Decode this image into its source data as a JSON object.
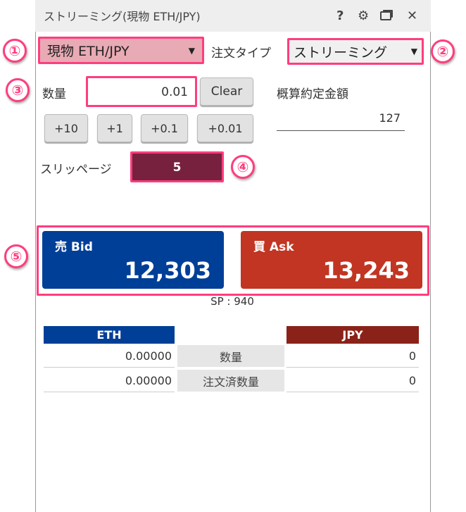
{
  "window": {
    "title": "ストリーミング(現物 ETH/JPY)",
    "icons": [
      "help-icon",
      "gear-icon",
      "restore-icon",
      "close-icon"
    ]
  },
  "annotations": [
    "①",
    "②",
    "③",
    "④",
    "⑤"
  ],
  "symbol_select": {
    "value": "現物 ETH/JPY"
  },
  "order_type": {
    "label": "注文タイプ",
    "value": "ストリーミング"
  },
  "quantity": {
    "label": "数量",
    "value": "0.01",
    "clear": "Clear",
    "steps": [
      "+10",
      "+1",
      "+0.1",
      "+0.01"
    ]
  },
  "estimate": {
    "label": "概算約定金額",
    "value": "127"
  },
  "slippage": {
    "label": "スリッページ",
    "value": "5"
  },
  "bid": {
    "label": "売 Bid",
    "price": "12,303"
  },
  "ask": {
    "label": "買 Ask",
    "price": "13,243"
  },
  "spread": "SP : 940",
  "balance": {
    "left_header": "ETH",
    "right_header": "JPY",
    "rows": [
      {
        "label": "数量",
        "left": "0.00000",
        "right": "0"
      },
      {
        "label": "注文済数量",
        "left": "0.00000",
        "right": "0"
      }
    ]
  },
  "colors": {
    "highlight": "#ff3d7f",
    "bid": "#003f97",
    "ask": "#c13522",
    "slippage": "#77213f",
    "symbol_bg": "#e8aab4"
  }
}
